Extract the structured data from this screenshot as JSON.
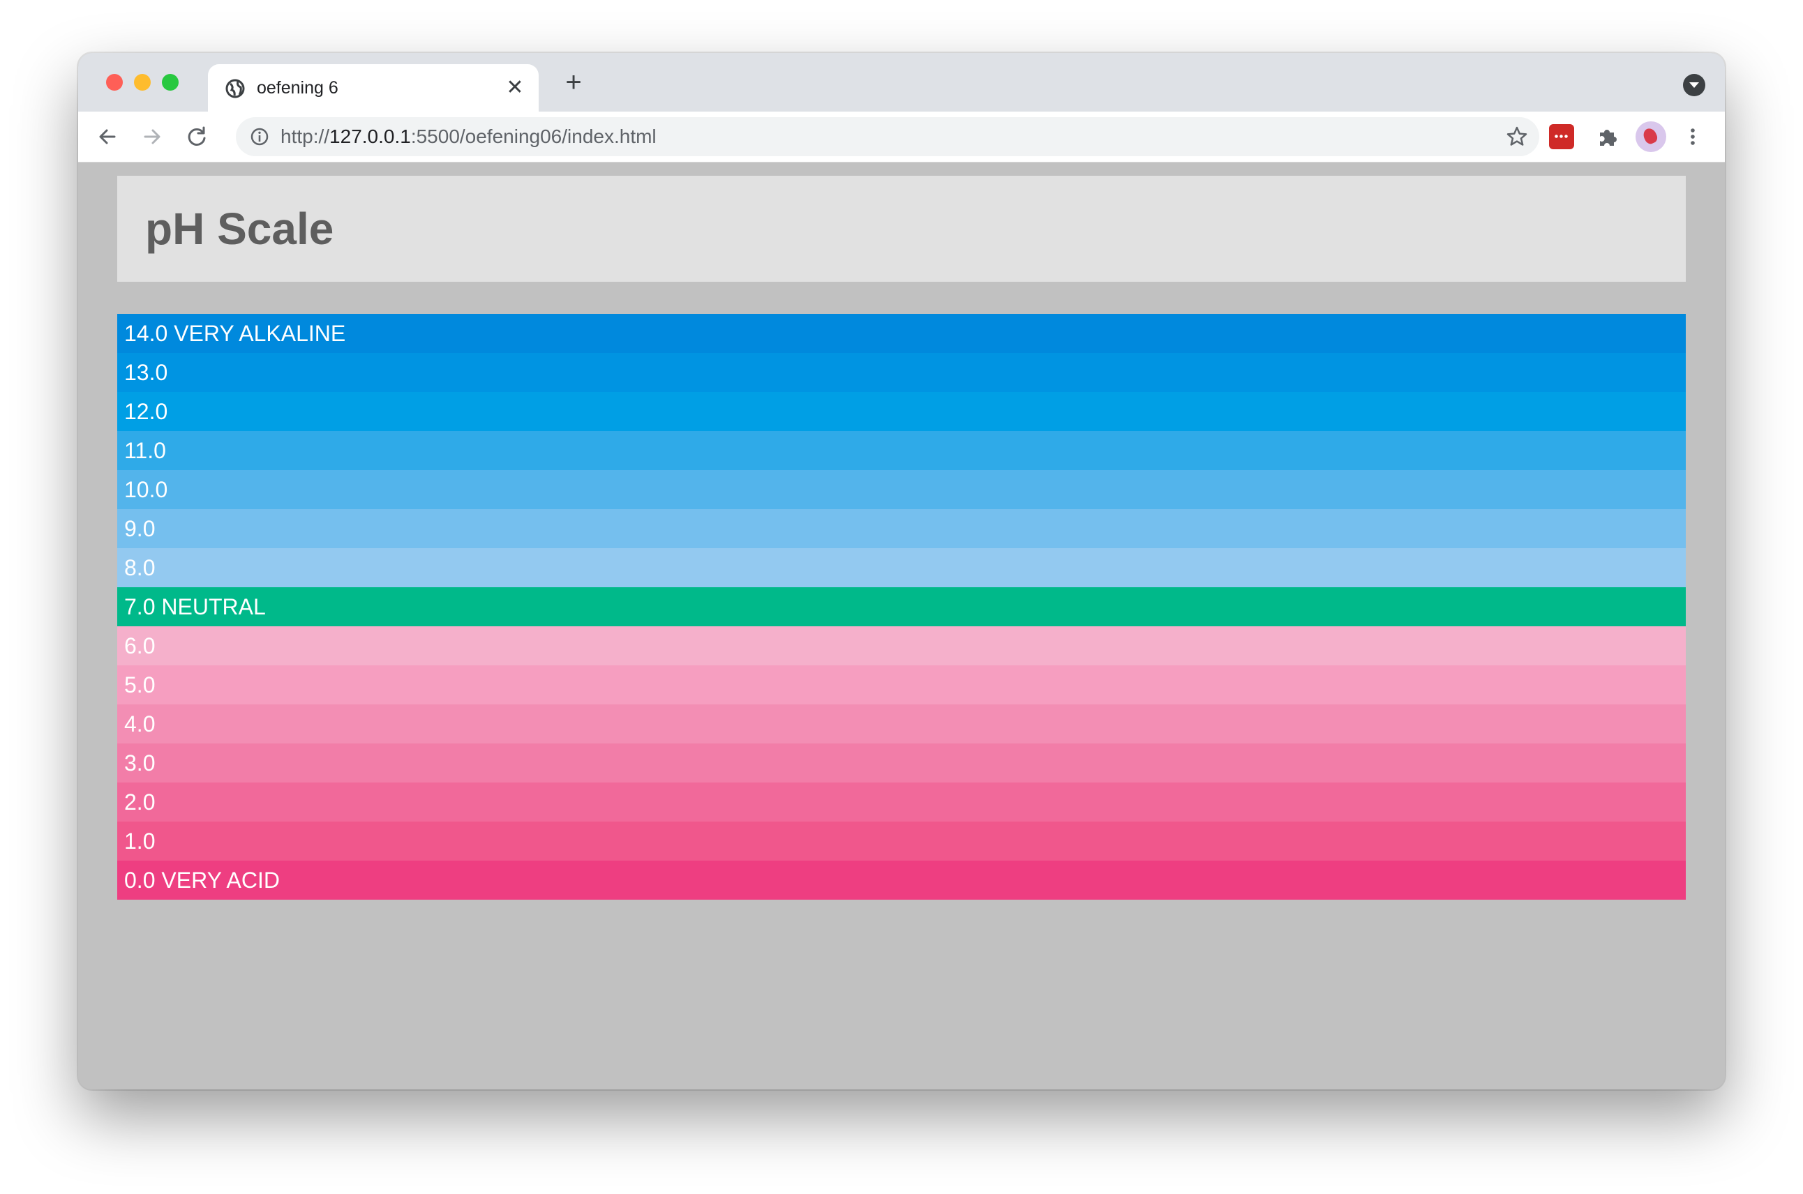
{
  "browser": {
    "tab": {
      "title": "oefening 6",
      "favicon_icon": "globe-icon",
      "close_symbol": "✕"
    },
    "new_tab_symbol": "+",
    "address": {
      "scheme": "http://",
      "host": "127.0.0.1",
      "path": ":5500/oefening06/index.html"
    },
    "toolbar_icons": [
      "back-arrow-icon",
      "forward-arrow-icon",
      "reload-icon",
      "info-icon",
      "star-icon",
      "extension-icon",
      "puzzle-icon",
      "profile-avatar",
      "more-vertical-icon"
    ]
  },
  "page": {
    "title": "pH Scale",
    "scale": [
      {
        "label": "14.0 VERY ALKALINE",
        "color": "#0089DD"
      },
      {
        "label": "13.0",
        "color": "#0094E2"
      },
      {
        "label": "12.0",
        "color": "#009FE5"
      },
      {
        "label": "11.0",
        "color": "#2FAAE8"
      },
      {
        "label": "10.0",
        "color": "#53B4EB"
      },
      {
        "label": "9.0",
        "color": "#75BFEE"
      },
      {
        "label": "8.0",
        "color": "#93C9F0"
      },
      {
        "label": "7.0 NEUTRAL",
        "color": "#00B98A"
      },
      {
        "label": "6.0",
        "color": "#F5B0CB"
      },
      {
        "label": "5.0",
        "color": "#F69EC0"
      },
      {
        "label": "4.0",
        "color": "#F38EB4"
      },
      {
        "label": "3.0",
        "color": "#F27DA8"
      },
      {
        "label": "2.0",
        "color": "#F1699A"
      },
      {
        "label": "1.0",
        "color": "#F0578C"
      },
      {
        "label": "0.0 VERY ACID",
        "color": "#EE3E81"
      }
    ]
  }
}
